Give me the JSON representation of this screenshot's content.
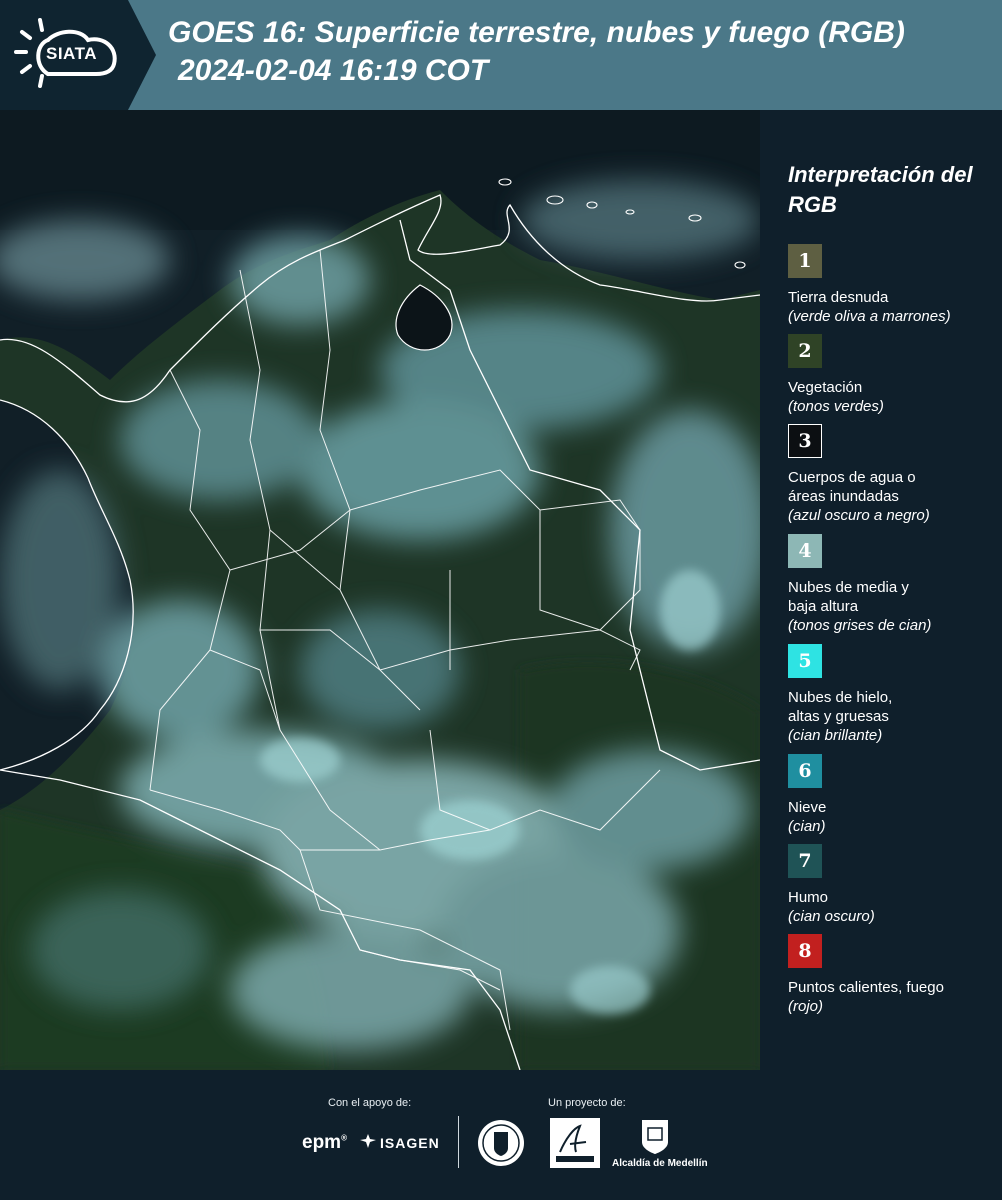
{
  "header": {
    "logo_text": "SIATA",
    "title_line1": "GOES 16: Superficie terrestre, nubes y fuego (RGB)",
    "title_line2": "2024-02-04 16:19 COT",
    "colors": {
      "band_dark": "#0f2430",
      "band_light": "#4b7888"
    }
  },
  "legend": {
    "title": "Interpretación del RGB",
    "items": [
      {
        "num": "1",
        "name": "Tierra desnuda",
        "desc": "(verde oliva a marrones)",
        "color": "#5e5f42"
      },
      {
        "num": "2",
        "name": "Vegetación",
        "desc": "(tonos verdes)",
        "color": "#2f4326"
      },
      {
        "num": "3",
        "name": "Cuerpos de agua o áreas inundadas",
        "desc": "(azul oscuro a negro)",
        "color": "#0c0f12"
      },
      {
        "num": "4",
        "name": "Nubes de media y baja altura",
        "desc": "(tonos grises de cian)",
        "color": "#8db7b5"
      },
      {
        "num": "5",
        "name": "Nubes de hielo, altas y gruesas",
        "desc": "(cian brillante)",
        "color": "#2ee3e3"
      },
      {
        "num": "6",
        "name": "Nieve",
        "desc": "(cian)",
        "color": "#1f8fa0"
      },
      {
        "num": "7",
        "name": "Humo",
        "desc": "(cian oscuro)",
        "color": "#1f5356"
      },
      {
        "num": "8",
        "name": "Puntos calientes, fuego",
        "desc": "(rojo)",
        "color": "#c2201f"
      }
    ]
  },
  "footer": {
    "support_label": "Con el apoyo de:",
    "project_label": "Un proyecto de:",
    "epm_logo": "epm",
    "isagen_logo": "ISAGEN",
    "alcaldia_logo": "Alcaldía de Medellín"
  }
}
